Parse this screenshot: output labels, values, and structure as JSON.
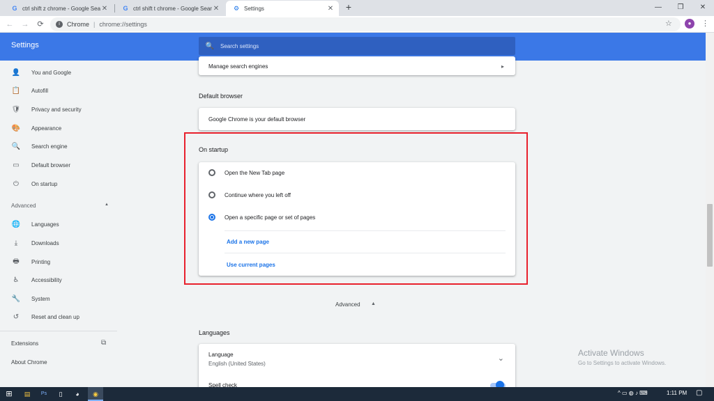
{
  "tabs": [
    {
      "favicon": "G",
      "title": "ctrl shift z chrome - Google Searc",
      "close": "✕"
    },
    {
      "favicon": "G",
      "title": "ctrl shift t chrome - Google Searc",
      "close": "✕"
    },
    {
      "favicon": "⚙",
      "title": "Settings",
      "close": "✕"
    }
  ],
  "new_tab": "+",
  "window_controls": {
    "minimize": "—",
    "maximize": "❐",
    "close": "✕"
  },
  "toolbar": {
    "back": "←",
    "forward": "→",
    "reload": "⟳",
    "site_name": "Chrome",
    "separator": "|",
    "url": "chrome://settings",
    "star": "☆",
    "avatar": "●",
    "menu": "⋮"
  },
  "header": {
    "title": "Settings",
    "search_placeholder": "Search settings"
  },
  "sidebar": {
    "items": [
      {
        "icon": "person-icon",
        "glyph": "👤",
        "label": "You and Google"
      },
      {
        "icon": "clipboard-icon",
        "glyph": "📋",
        "label": "Autofill"
      },
      {
        "icon": "shield-icon",
        "glyph": "🛡",
        "label": "Privacy and security"
      },
      {
        "icon": "palette-icon",
        "glyph": "🎨",
        "label": "Appearance"
      },
      {
        "icon": "search-icon",
        "glyph": "🔍",
        "label": "Search engine"
      },
      {
        "icon": "browser-icon",
        "glyph": "▭",
        "label": "Default browser"
      },
      {
        "icon": "power-icon",
        "glyph": "⏻",
        "label": "On startup"
      }
    ],
    "advanced_label": "Advanced",
    "advanced_arrow": "▲",
    "advanced_items": [
      {
        "icon": "globe-icon",
        "glyph": "🌐",
        "label": "Languages"
      },
      {
        "icon": "download-icon",
        "glyph": "⤓",
        "label": "Downloads"
      },
      {
        "icon": "printer-icon",
        "glyph": "🖶",
        "label": "Printing"
      },
      {
        "icon": "accessibility-icon",
        "glyph": "♿",
        "label": "Accessibility"
      },
      {
        "icon": "wrench-icon",
        "glyph": "🔧",
        "label": "System"
      },
      {
        "icon": "restore-icon",
        "glyph": "↺",
        "label": "Reset and clean up"
      }
    ],
    "extensions": "Extensions",
    "extensions_open": "⧉",
    "about": "About Chrome"
  },
  "main": {
    "manage_search_engines": "Manage search engines",
    "chevron": "▸",
    "default_browser_title": "Default browser",
    "default_browser_text": "Google Chrome is your default browser",
    "on_startup_title": "On startup",
    "startup_options": [
      {
        "label": "Open the New Tab page",
        "checked": false
      },
      {
        "label": "Continue where you left off",
        "checked": false
      },
      {
        "label": "Open a specific page or set of pages",
        "checked": true
      }
    ],
    "add_new_page": "Add a new page",
    "use_current_pages": "Use current pages",
    "advanced_toggle": "Advanced",
    "advanced_toggle_arrow": "▲",
    "languages_title": "Languages",
    "language_label": "Language",
    "language_value": "English (United States)",
    "language_chevron": "⌄",
    "spell_check": "Spell check",
    "spell_check_on": true
  },
  "watermark": {
    "line1": "Activate Windows",
    "line2": "Go to Settings to activate Windows."
  },
  "taskbar": {
    "start": "⊞",
    "apps": [
      "▤",
      "Ps",
      "▯",
      "◕",
      "◉"
    ],
    "tray": "^  ▭  ◍  ♪  ⌨",
    "clock": "1:11 PM",
    "notification": "▢"
  }
}
